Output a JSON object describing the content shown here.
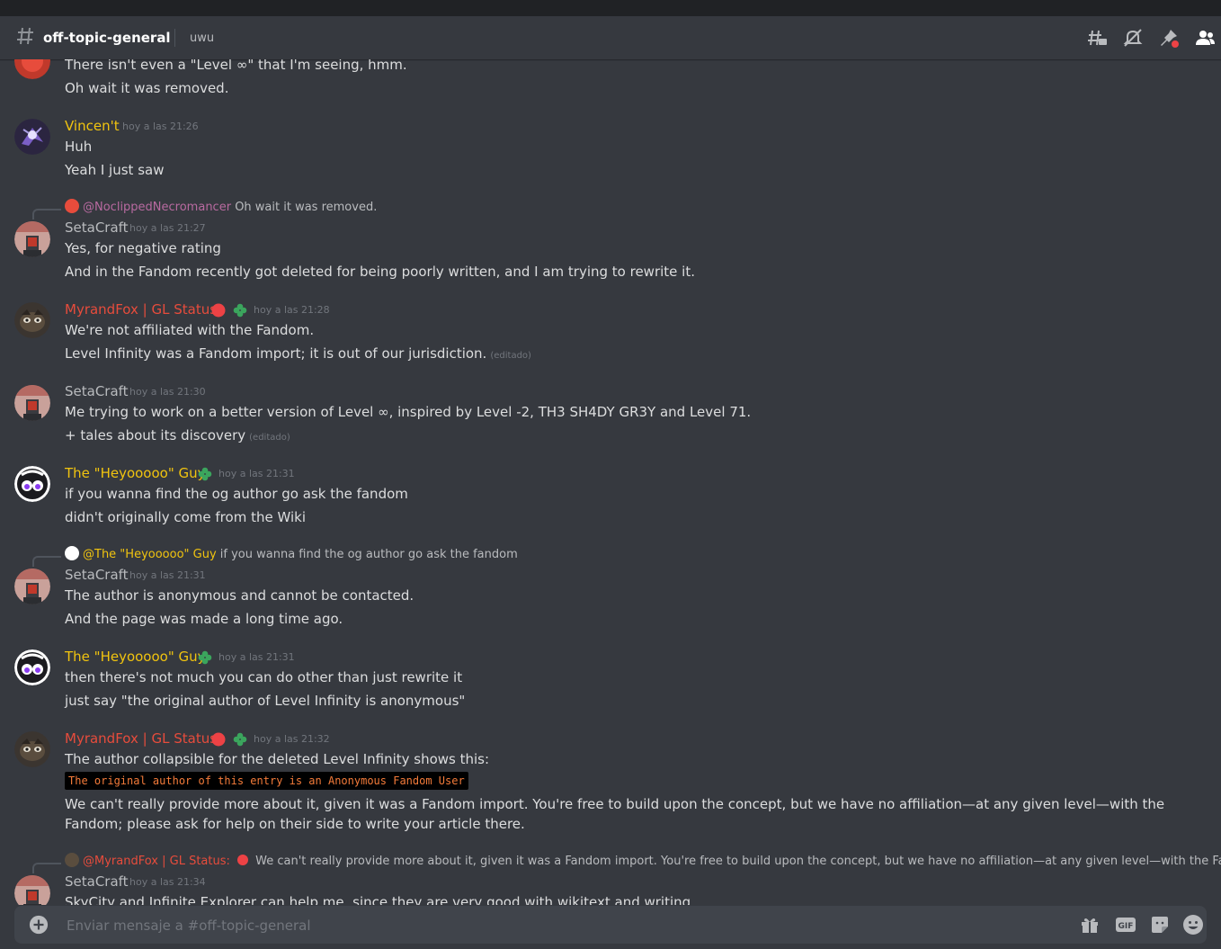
{
  "header": {
    "channel_name": "off-topic-general",
    "topic": "uwu"
  },
  "colors": {
    "username_yellow": "#f1c40f",
    "username_red": "#e74c3c",
    "username_gray": "#b9bbbe",
    "status_red": "#ed4245",
    "clover_green": "#3ba55d",
    "code_orange": "#f47b3a"
  },
  "messages": {
    "m0": {
      "lines": [
        "There isn't even a \"Level ∞\" that I'm seeing, hmm.",
        "Oh wait it was removed."
      ]
    },
    "m1": {
      "username": "Vincen't",
      "timestamp": "hoy a las 21:26",
      "lines": [
        "Huh",
        "Yeah I just saw"
      ]
    },
    "m2": {
      "reply_name": "@NoclippedNecromancer",
      "reply_text": "Oh wait it was removed.",
      "username": "SetaCraft",
      "timestamp": "hoy a las 21:27",
      "lines": [
        "Yes, for negative rating",
        "And in the Fandom recently got deleted for being poorly written, and I am trying to rewrite it."
      ]
    },
    "m3": {
      "username": "MyrandFox | GL Status:",
      "timestamp": "hoy a las 21:28",
      "lines": [
        "We're not affiliated with the Fandom.",
        "Level Infinity was a Fandom import; it is out of our jurisdiction."
      ],
      "edited": "(editado)"
    },
    "m4": {
      "username": "SetaCraft",
      "timestamp": "hoy a las 21:30",
      "lines": [
        "Me trying to work on a better version of Level ∞, inspired by Level -2, TH3 SH4DY GR3Y and Level 71.",
        "+ tales about its discovery"
      ],
      "edited": "(editado)"
    },
    "m5": {
      "username": "The \"Heyooooo\" Guy",
      "timestamp": "hoy a las 21:31",
      "lines": [
        "if you wanna find the og author go ask the fandom",
        "didn't originally come from the Wiki"
      ]
    },
    "m6": {
      "reply_name": "@The \"Heyooooo\" Guy",
      "reply_text": "if you wanna find the og author go ask the fandom",
      "username": "SetaCraft",
      "timestamp": "hoy a las 21:31",
      "lines": [
        "The author is anonymous and cannot be contacted.",
        "And the page was made a long time ago."
      ]
    },
    "m7": {
      "username": "The \"Heyooooo\" Guy",
      "timestamp": "hoy a las 21:31",
      "lines": [
        "then there's not much you can do other than just rewrite it",
        "just say \"the original author of Level Infinity is anonymous\""
      ]
    },
    "m8": {
      "username": "MyrandFox | GL Status:",
      "timestamp": "hoy a las 21:32",
      "lines": [
        "The author collapsible for the deleted Level Infinity shows this:"
      ],
      "code": "The original author of this entry is an Anonymous Fandom User",
      "paragraph": "We can't really provide more about it, given it was a Fandom import. You're free to build upon the concept, but we have no affiliation—at any given level—with the Fandom; please ask for help on their side to write your article there."
    },
    "m9": {
      "reply_name": "@MyrandFox | GL Status:",
      "reply_text": "We can't really provide more about it, given it was a Fandom import. You're free to build upon the concept, but we have no affiliation—at any given level—with the Fandom; pleas...",
      "username": "SetaCraft",
      "timestamp": "hoy a las 21:34",
      "lines": [
        "SkyCity and Infinite Explorer can help me, since they are very good with wikitext and writing."
      ]
    }
  },
  "composer": {
    "placeholder": "Enviar mensaje a #off-topic-general"
  },
  "icons": {
    "header": [
      "threads-icon",
      "mute-bell-icon",
      "pin-icon",
      "members-icon"
    ],
    "composer": [
      "add-attachment-icon",
      "gift-icon",
      "gif-icon",
      "sticker-icon",
      "emoji-icon"
    ]
  }
}
